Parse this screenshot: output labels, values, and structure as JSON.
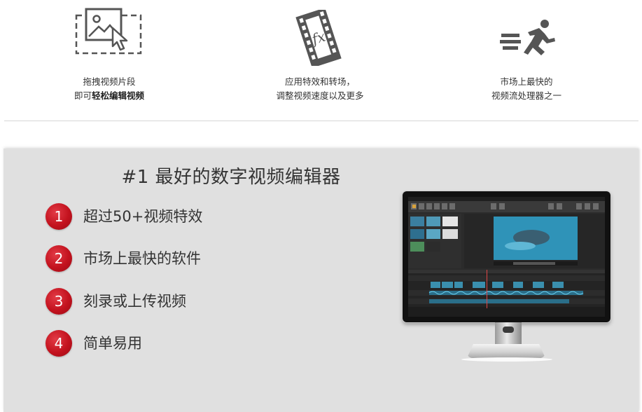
{
  "features": [
    {
      "icon": "drag-image-icon",
      "line1": "拖拽视频片段",
      "line2_prefix": "即可",
      "line2_bold": "轻松编辑视频"
    },
    {
      "icon": "film-fx-icon",
      "line1": "应用特效和转场，",
      "line2_prefix": "调整视频速度以及更多",
      "line2_bold": ""
    },
    {
      "icon": "running-man-icon",
      "line1": "市场上最快的",
      "line2_prefix": "视频流处理器之一",
      "line2_bold": ""
    }
  ],
  "promo": {
    "title": "#1 最好的数字视频编辑器",
    "items": [
      {
        "num": "1",
        "label": "超过50+视频特效"
      },
      {
        "num": "2",
        "label": "市场上最快的软件"
      },
      {
        "num": "3",
        "label": "刻录或上传视频"
      },
      {
        "num": "4",
        "label": "简单易用"
      }
    ]
  },
  "colors": {
    "accent_red": "#c3121e",
    "panel_bg": "#e0e0e0",
    "icon_gray": "#555555"
  }
}
